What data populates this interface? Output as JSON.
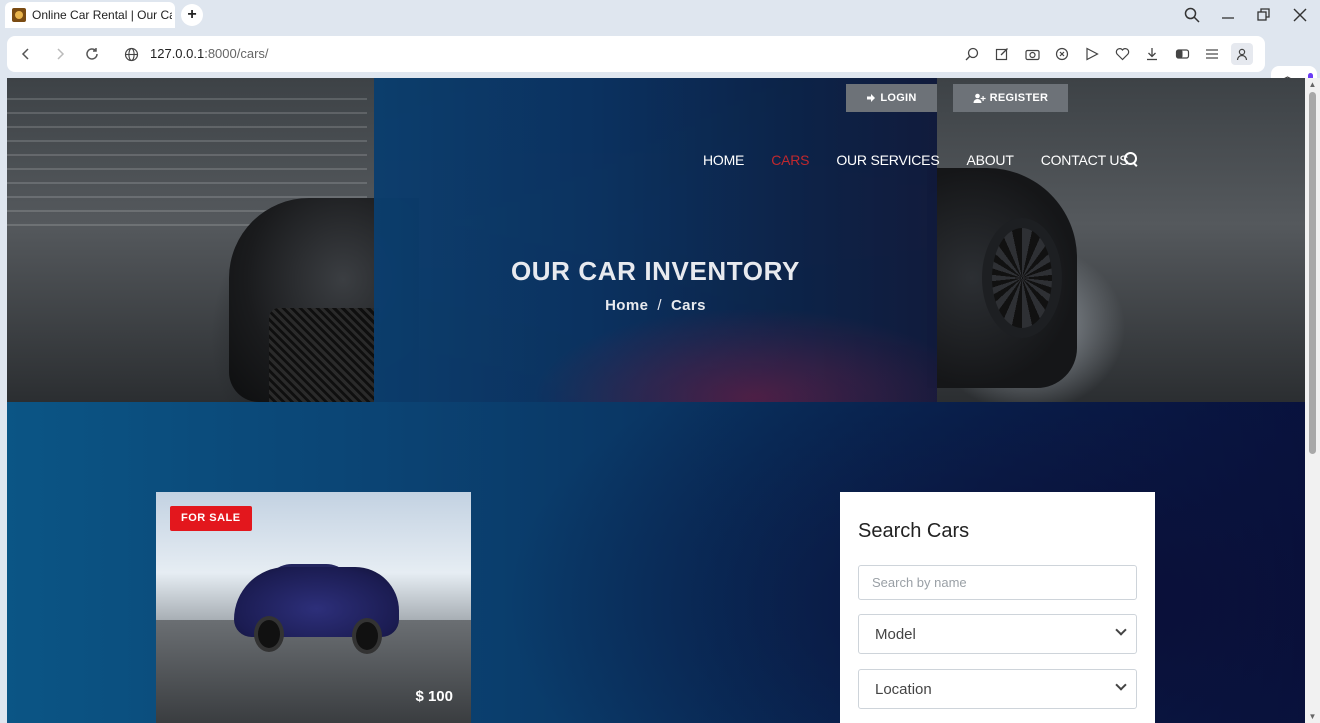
{
  "browser": {
    "tab_title": "Online Car Rental | Our Ca",
    "new_tab_symbol": "+",
    "url_host": "127.0.0.1",
    "url_rest": ":8000/cars/",
    "window_controls": [
      "search-icon",
      "minimize-icon",
      "restore-icon",
      "close-icon"
    ],
    "toolbar_icons": [
      "zoom-icon",
      "edit-icon",
      "camera-icon",
      "shield-icon",
      "send-icon",
      "heart-icon",
      "download-icon",
      "battery-icon",
      "menu-icon",
      "profile-icon"
    ]
  },
  "header": {
    "login_label": "LOGIN",
    "register_label": "REGISTER",
    "nav": [
      {
        "label": "HOME",
        "active": false
      },
      {
        "label": "CARS",
        "active": true
      },
      {
        "label": "OUR SERVICES",
        "active": false
      },
      {
        "label": "ABOUT",
        "active": false
      },
      {
        "label": "CONTACT US",
        "active": false
      }
    ],
    "active_color": "#c0282e"
  },
  "hero": {
    "title": "OUR CAR INVENTORY",
    "breadcrumb": [
      "Home",
      "Cars"
    ],
    "breadcrumb_separator": "/"
  },
  "listing": {
    "badge": "FOR SALE",
    "badge_color": "#e3171d",
    "price": "$ 100"
  },
  "search": {
    "title": "Search Cars",
    "name_placeholder": "Search by name",
    "model_selected": "Model",
    "location_selected": "Location"
  }
}
